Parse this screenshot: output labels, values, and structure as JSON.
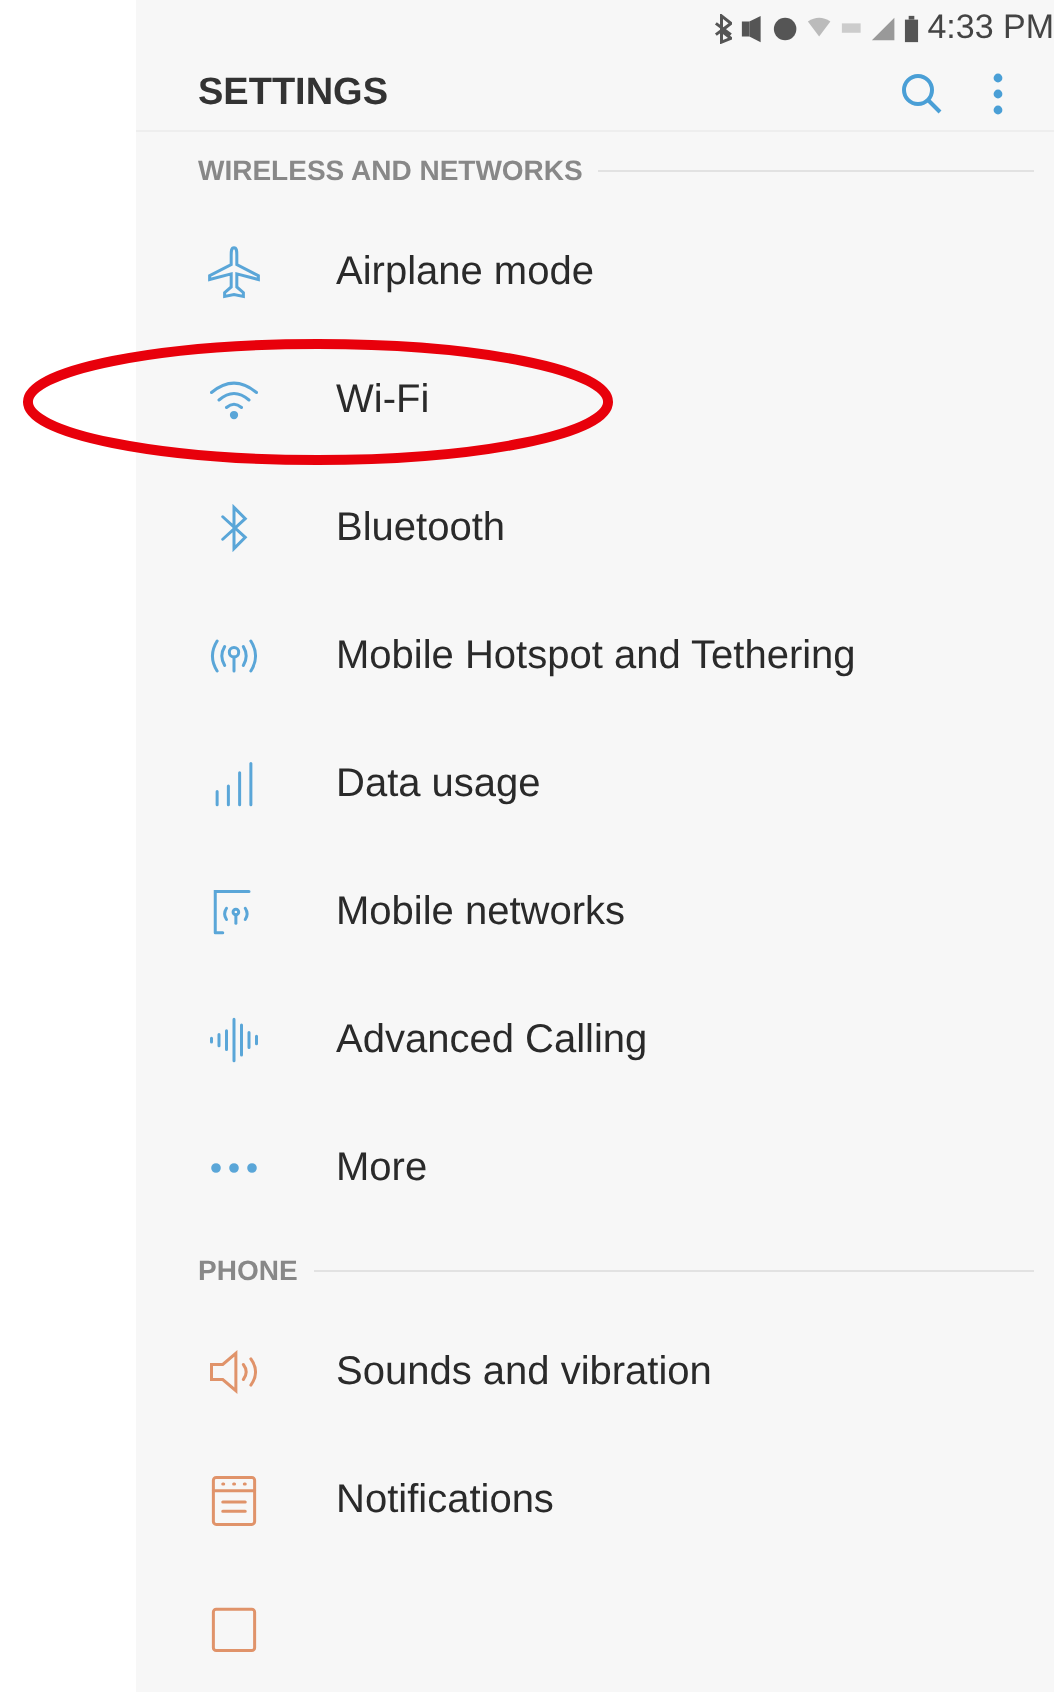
{
  "status_bar": {
    "time": "4:33 PM"
  },
  "header": {
    "title": "SETTINGS"
  },
  "sections": [
    {
      "title": "WIRELESS AND NETWORKS",
      "color": "#5aa6d8",
      "items": [
        {
          "kind": "airplane",
          "label": "Airplane mode",
          "highlighted": false
        },
        {
          "kind": "wifi",
          "label": "Wi-Fi",
          "highlighted": true
        },
        {
          "kind": "bluetooth",
          "label": "Bluetooth",
          "highlighted": false
        },
        {
          "kind": "hotspot",
          "label": "Mobile Hotspot and Tethering",
          "highlighted": false
        },
        {
          "kind": "bars",
          "label": "Data usage",
          "highlighted": false
        },
        {
          "kind": "network",
          "label": "Mobile networks",
          "highlighted": false
        },
        {
          "kind": "wave",
          "label": "Advanced Calling",
          "highlighted": false
        },
        {
          "kind": "dots",
          "label": "More",
          "highlighted": false
        }
      ]
    },
    {
      "title": "PHONE",
      "color": "#e0936a",
      "items": [
        {
          "kind": "speaker",
          "label": "Sounds and vibration",
          "highlighted": false
        },
        {
          "kind": "notifications",
          "label": "Notifications",
          "highlighted": false
        },
        {
          "kind": "display",
          "highlighted": false
        }
      ]
    }
  ]
}
